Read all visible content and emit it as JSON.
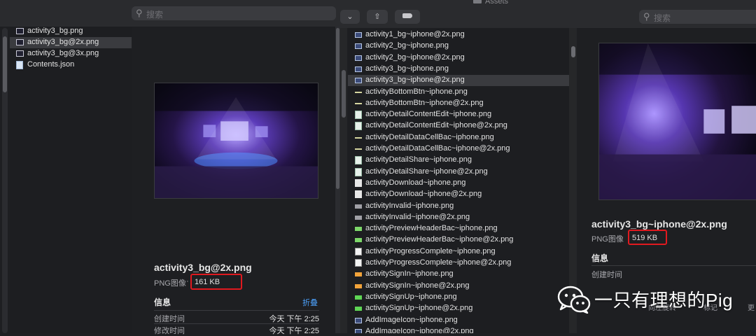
{
  "left_window": {
    "search_placeholder": "搜索",
    "files": [
      {
        "name": "activity3_bg.png",
        "icon": "image-file-icon",
        "selected": false
      },
      {
        "name": "activity3_bg@2x.png",
        "icon": "image-file-icon",
        "selected": true
      },
      {
        "name": "activity3_bg@3x.png",
        "icon": "image-file-icon",
        "selected": false
      },
      {
        "name": "Contents.json",
        "icon": "json-file-icon",
        "selected": false
      }
    ],
    "preview": {
      "file_name": "activity3_bg@2x.png",
      "kind": "PNG图像",
      "separator": "·",
      "size": "161 KB",
      "info_title": "信息",
      "collapse_link": "折叠",
      "rows": [
        {
          "label": "创建时间",
          "value": "今天 下午 2:25"
        },
        {
          "label": "修改时间",
          "value": "今天 下午 2:25"
        }
      ]
    }
  },
  "right_window": {
    "title": "Assets",
    "search_placeholder": "搜索",
    "toolbar": {
      "dropdown_chevron": "⌄",
      "share_icon": "⇧",
      "tag_icon": "tag-icon"
    },
    "assets": [
      {
        "name": "activity1_bg~iphone@2x.png",
        "icon": "img",
        "selected": false
      },
      {
        "name": "activity2_bg~iphone.png",
        "icon": "img",
        "selected": false
      },
      {
        "name": "activity2_bg~iphone@2x.png",
        "icon": "img",
        "selected": false
      },
      {
        "name": "activity3_bg~iphone.png",
        "icon": "img",
        "selected": false
      },
      {
        "name": "activity3_bg~iphone@2x.png",
        "icon": "img",
        "selected": true
      },
      {
        "name": "activityBottomBtn~iphone.png",
        "icon": "bar",
        "selected": false
      },
      {
        "name": "activityBottomBtn~iphone@2x.png",
        "icon": "bar",
        "selected": false
      },
      {
        "name": "activityDetailContentEdit~iphone.png",
        "icon": "doc",
        "selected": false
      },
      {
        "name": "activityDetailContentEdit~iphone@2x.png",
        "icon": "doc",
        "selected": false
      },
      {
        "name": "activityDetailDataCellBac~iphone.png",
        "icon": "bar",
        "selected": false
      },
      {
        "name": "activityDetailDataCellBac~iphone@2x.png",
        "icon": "bar",
        "selected": false
      },
      {
        "name": "activityDetailShare~iphone.png",
        "icon": "doc",
        "selected": false
      },
      {
        "name": "activityDetailShare~iphone@2x.png",
        "icon": "doc",
        "selected": false
      },
      {
        "name": "activityDownload~iphone.png",
        "icon": "dl",
        "selected": false
      },
      {
        "name": "activityDownload~iphone@2x.png",
        "icon": "dl",
        "selected": false
      },
      {
        "name": "activityInvalid~iphone.png",
        "icon": "gray",
        "selected": false
      },
      {
        "name": "activityInvalid~iphone@2x.png",
        "icon": "gray",
        "selected": false
      },
      {
        "name": "activityPreviewHeaderBac~iphone.png",
        "icon": "green",
        "selected": false
      },
      {
        "name": "activityPreviewHeaderBac~iphone@2x.png",
        "icon": "green",
        "selected": false
      },
      {
        "name": "activityProgressComplete~iphone.png",
        "icon": "check",
        "selected": false
      },
      {
        "name": "activityProgressComplete~iphone@2x.png",
        "icon": "check",
        "selected": false
      },
      {
        "name": "activitySignIn~iphone.png",
        "icon": "orange",
        "selected": false
      },
      {
        "name": "activitySignIn~iphone@2x.png",
        "icon": "orange",
        "selected": false
      },
      {
        "name": "activitySignUp~iphone.png",
        "icon": "gbar",
        "selected": false
      },
      {
        "name": "activitySignUp~iphone@2x.png",
        "icon": "gbar",
        "selected": false
      },
      {
        "name": "AddImageIcon~iphone.png",
        "icon": "img",
        "selected": false
      },
      {
        "name": "AddImageIcon~iphone@2x.png",
        "icon": "img",
        "selected": false
      }
    ],
    "preview": {
      "file_name": "activity3_bg~iphone@2x.png",
      "kind": "PNG图像",
      "size": "519 KB",
      "info_title": "信息",
      "rows": [
        {
          "label": "创建时间"
        }
      ]
    },
    "bottom_tools": [
      "向左旋转",
      "标记",
      "更"
    ]
  },
  "watermark": {
    "text": "一只有理想的Pig"
  },
  "colors": {
    "highlight_box": "#e0191f",
    "link": "#4da3ff",
    "background": "#1e1f22"
  }
}
